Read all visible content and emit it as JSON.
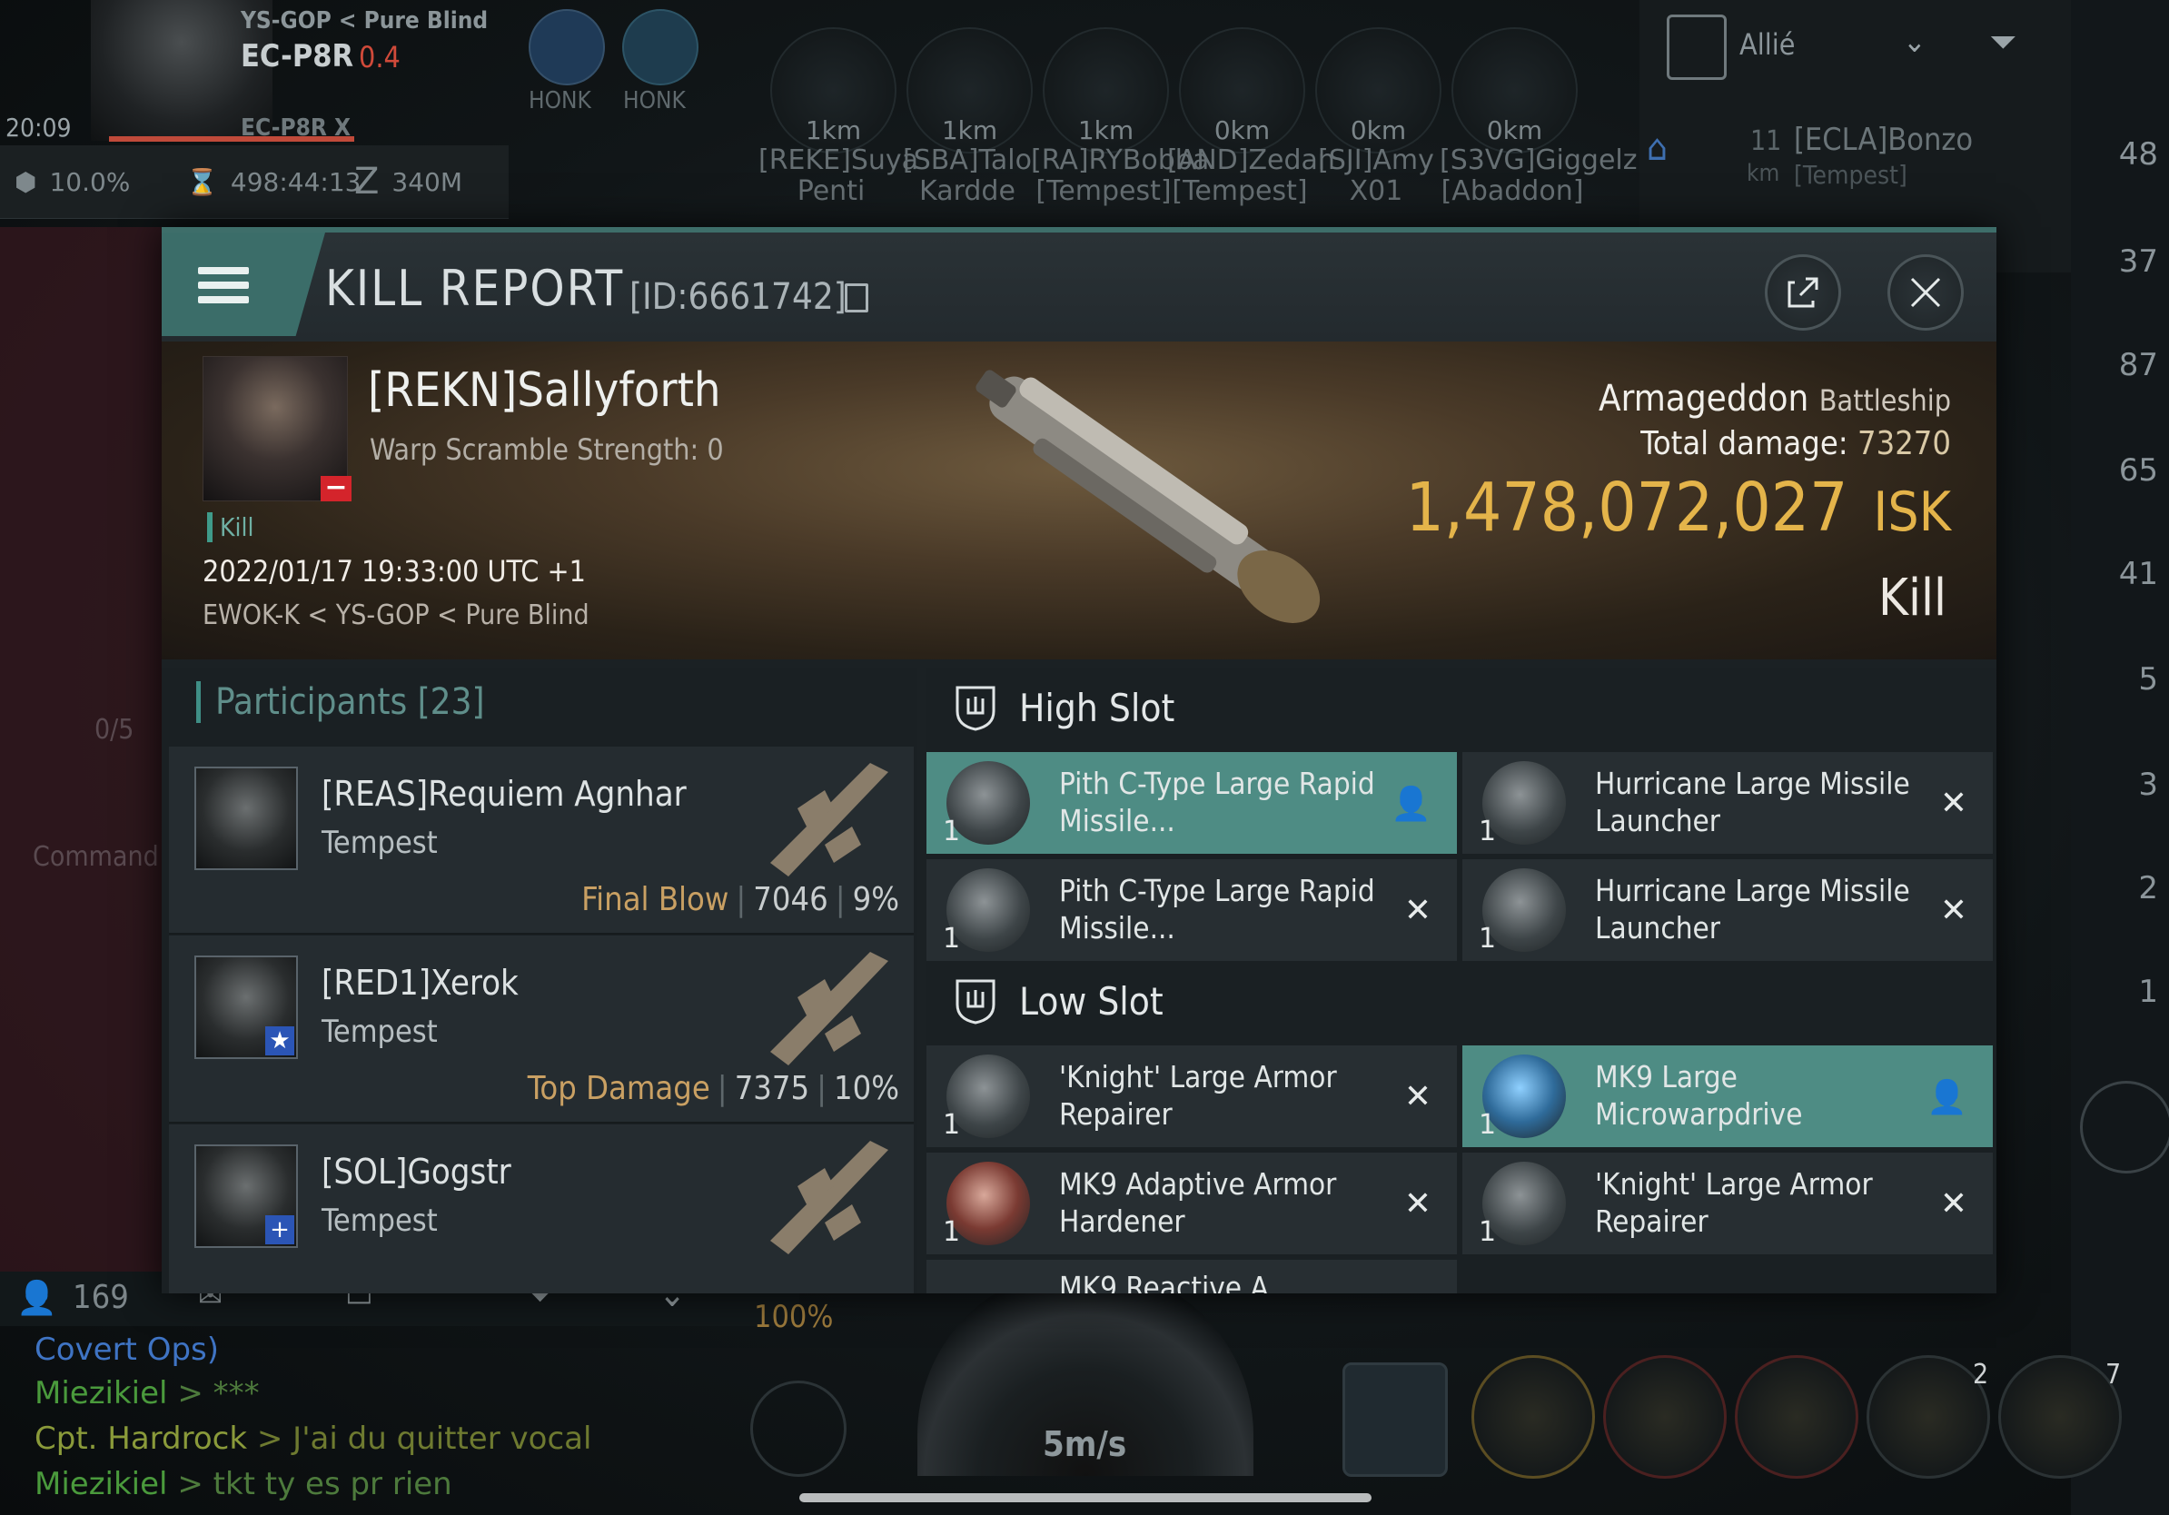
{
  "hud": {
    "system_path": "YS-GOP < Pure Blind",
    "system_name": "EC-P8R",
    "security": "0.4",
    "time": "20:09",
    "station_label": "EC-P8R X",
    "fleet_tags": [
      "HONK",
      "HONK"
    ],
    "status_percent": "10.0%",
    "status_timer": "498:44:13",
    "status_range": "340M",
    "fleet_members": [
      {
        "dist": "1km",
        "name": "[REKE]Suya Penti"
      },
      {
        "dist": "1km",
        "name": "[SBA]Talo Kardde"
      },
      {
        "dist": "1km",
        "name": "[RA]RYBobba [Tempest]"
      },
      {
        "dist": "0km",
        "name": "[AND]Zedan [Tempest]"
      },
      {
        "dist": "0km",
        "name": "[SJI]Amy X01"
      },
      {
        "dist": "0km",
        "name": "[S3VG]Giggelz [Abaddon]"
      }
    ],
    "overview_filter": "Allié",
    "overview_entry": {
      "dist": "11",
      "unit": "km",
      "name": "[ECLA]Bonzo",
      "ship": "[Tempest]"
    },
    "sidebar_counts": [
      "48",
      "37",
      "87",
      "65",
      "41",
      "5",
      "3",
      "2",
      "1"
    ],
    "left_labels": [
      "0/5",
      "Command"
    ],
    "local_count": "169",
    "speed_percent": "100%",
    "speed": "5m/s",
    "module_badges": [
      "2",
      "7"
    ],
    "chat": [
      {
        "name": "Covert Ops)",
        "msg": "",
        "color": "#3f74c4"
      },
      {
        "name": "Miezikiel",
        "msg": "> ***",
        "color": "#4a9a3c"
      },
      {
        "name": "Cpt. Hardrock",
        "msg": "> J'ai du quitter vocal",
        "color": "#8a9a3a"
      },
      {
        "name": "Miezikiel",
        "msg": "> tkt ty es pr rien",
        "color": "#4a9a3c"
      }
    ]
  },
  "kill_report": {
    "title": "KILL REPORT",
    "id": "[ID:6661742]",
    "victim": {
      "name": "[REKN]Sallyforth",
      "warp_scramble": "Warp Scramble Strength: 0",
      "tag": "Kill",
      "date": "2022/01/17 19:33:00 UTC +1",
      "location": "EWOK-K < YS-GOP < Pure Blind"
    },
    "ship": {
      "name": "Armageddon",
      "class": "Battleship"
    },
    "total_damage_label": "Total damage:",
    "total_damage": "73270",
    "isk_value": "1,478,072,027",
    "isk_unit": "ISK",
    "result": "Kill",
    "participants_label": "Participants",
    "participants_count": "[23]",
    "participants": [
      {
        "name": "[REAS]Requiem Agnhar",
        "ship": "Tempest",
        "tag": "Final Blow",
        "damage": "7046",
        "percent": "9%",
        "badge": ""
      },
      {
        "name": "[RED1]Xerok",
        "ship": "Tempest",
        "tag": "Top Damage",
        "damage": "7375",
        "percent": "10%",
        "badge": "★"
      },
      {
        "name": "[SOL]Gogstr",
        "ship": "Tempest",
        "tag": "",
        "damage": "",
        "percent": "",
        "badge": "+"
      }
    ],
    "high_slot_label": "High Slot",
    "low_slot_label": "Low Slot",
    "high_slot": [
      {
        "qty": "1",
        "name": "Pith C-Type Large Rapid Missile...",
        "state": "dropped"
      },
      {
        "qty": "1",
        "name": "Hurricane Large Missile Launcher",
        "state": "destroyed"
      },
      {
        "qty": "1",
        "name": "Pith C-Type Large Rapid Missile...",
        "state": "destroyed"
      },
      {
        "qty": "1",
        "name": "Hurricane Large Missile Launcher",
        "state": "destroyed"
      }
    ],
    "low_slot": [
      {
        "qty": "1",
        "name": "'Knight' Large Armor Repairer",
        "state": "destroyed"
      },
      {
        "qty": "1",
        "name": "MK9 Large Microwarpdrive",
        "state": "dropped"
      },
      {
        "qty": "1",
        "name": "MK9 Adaptive Armor Hardener",
        "state": "destroyed"
      },
      {
        "qty": "1",
        "name": "'Knight' Large Armor Repairer",
        "state": "destroyed"
      }
    ],
    "partial_row_text": "MK9 Reactive A..."
  },
  "colors": {
    "accent": "#3f8f86",
    "isk": "#e4b44a",
    "highlight_row": "#4e8c84",
    "tag": "#c9a063"
  },
  "icons": [
    "menu-icon",
    "copy-icon",
    "share-icon",
    "close-icon",
    "shield-slot-icon",
    "person-icon",
    "x-icon"
  ]
}
